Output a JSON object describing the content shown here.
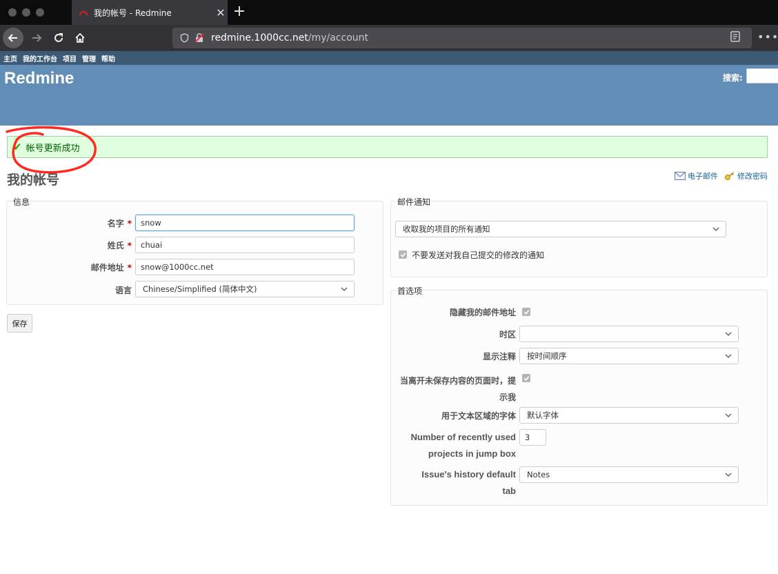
{
  "browser": {
    "tab_title": "我的帐号 - Redmine",
    "tab_close": "✕",
    "new_tab": "+",
    "url_host": "redmine.1000cc.net",
    "url_path": "/my/account",
    "menu_dots": "•••"
  },
  "top_menu": [
    "主页",
    "我的工作台",
    "项目",
    "管理",
    "帮助"
  ],
  "header": {
    "site_title": "Redmine",
    "search_label": "搜索:"
  },
  "flash": {
    "message": "帐号更新成功",
    "annotation_color": "#ff2a1f"
  },
  "page": {
    "title": "我的帐号",
    "contextual": [
      {
        "label": "电子邮件",
        "icon": "email-icon"
      },
      {
        "label": "修改密码",
        "icon": "key-icon"
      }
    ]
  },
  "info": {
    "legend": "信息",
    "fields": [
      {
        "label": "名字",
        "required": "*",
        "value": "snow"
      },
      {
        "label": "姓氏",
        "required": "*",
        "value": "chuai"
      },
      {
        "label": "邮件地址",
        "required": "*",
        "value": "snow@1000cc.net"
      }
    ],
    "language_label": "语言",
    "language_value": "Chinese/Simplified (简体中文)",
    "save_button": "保存"
  },
  "mail": {
    "legend": "邮件通知",
    "option": "收取我的项目的所有通知",
    "no_self_notified_label": "不要发送对我自己提交的修改的通知",
    "no_self_notified_checked": true
  },
  "prefs": {
    "legend": "首选项",
    "hide_mail_label": "隐藏我的邮件地址",
    "hide_mail_checked": true,
    "timezone_label": "时区",
    "timezone_value": "",
    "comments_label": "显示注释",
    "comments_value": "按时间顺序",
    "warn_label_1": "当离开未保存内容的页面时，提",
    "warn_label_2": "示我",
    "warn_checked": true,
    "font_label": "用于文本区域的字体",
    "font_value": "默认字体",
    "recent_label_1": "Number of recently used",
    "recent_label_2": "projects in jump box",
    "recent_value": "3",
    "history_label_1": "Issue's history default",
    "history_label_2": "tab",
    "history_value": "Notes"
  },
  "colors": {
    "header": "#628db6",
    "top_menu": "#3e5b76",
    "flash_bg": "#dfffdf",
    "link": "#116699"
  }
}
